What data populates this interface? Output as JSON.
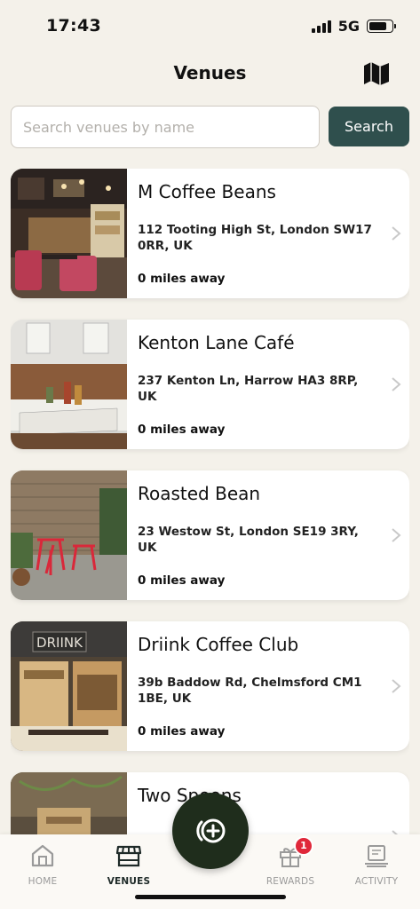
{
  "status_bar": {
    "time": "17:43",
    "network": "5G"
  },
  "header": {
    "title": "Venues",
    "map_icon": "map-icon"
  },
  "search": {
    "placeholder": "Search venues by name",
    "value": "",
    "button_label": "Search"
  },
  "venues": [
    {
      "name": "M Coffee Beans",
      "address": "112 Tooting High St, London SW17 0RR, UK",
      "distance": "0 miles away"
    },
    {
      "name": "Kenton Lane Café",
      "address": "237 Kenton Ln, Harrow HA3 8RP, UK",
      "distance": "0 miles away"
    },
    {
      "name": "Roasted Bean",
      "address": "23 Westow St, London SE19 3RY, UK",
      "distance": "0 miles away"
    },
    {
      "name": "Driink Coffee Club",
      "address": "39b Baddow Rd, Chelmsford CM1 1BE, UK",
      "distance": "0 miles away"
    },
    {
      "name": "Two Spoons",
      "address": "",
      "distance": ""
    }
  ],
  "photo_signs": {
    "driink": "DRIINK"
  },
  "nav": {
    "home": "HOME",
    "venues": "VENUES",
    "rewards": "REWARDS",
    "activity": "ACTIVITY",
    "rewards_badge": "1"
  },
  "colors": {
    "background": "#f4f1ea",
    "accent": "#2f4f4d",
    "fab": "#1f2d1c",
    "badge": "#e0283a"
  }
}
